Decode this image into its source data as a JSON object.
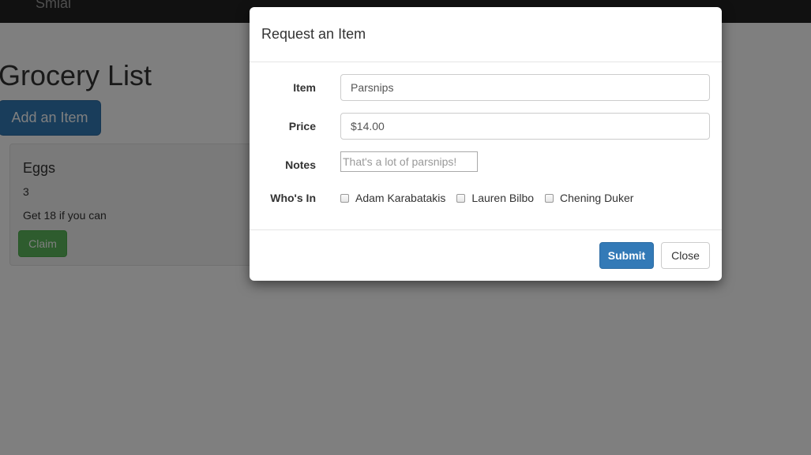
{
  "navbar": {
    "brand": "Smiai"
  },
  "page": {
    "title": "Grocery List",
    "add_button_label": "Add an Item"
  },
  "item_card": {
    "name": "Eggs",
    "quantity": "3",
    "notes": "Get 18 if you can",
    "claim_label": "Claim"
  },
  "modal": {
    "title": "Request an Item",
    "fields": {
      "item": {
        "label": "Item",
        "value": "Parsnips"
      },
      "price": {
        "label": "Price",
        "value": "$14.00"
      },
      "notes": {
        "label": "Notes",
        "placeholder": "That's a lot of parsnips!"
      },
      "whos_in": {
        "label": "Who's In",
        "people": [
          "Adam Karabatakis",
          "Lauren Bilbo",
          "Chening Duker"
        ]
      }
    },
    "submit_label": "Submit",
    "close_label": "Close"
  },
  "colors": {
    "primary": "#337ab7",
    "success": "#5cb85c",
    "navbar": "#222222"
  }
}
